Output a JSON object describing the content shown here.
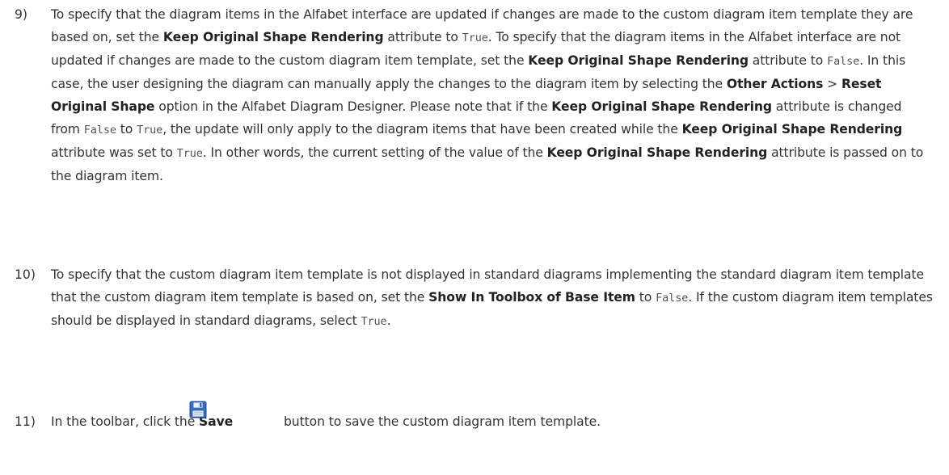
{
  "colors": {
    "text": "#333333",
    "bold_text": "#222222",
    "code_text": "#555555",
    "save_icon": "#3a6fc4"
  },
  "step9": {
    "number": "9)",
    "p1": "To specify that the diagram items in the Alfabet interface are updated if changes are made to the custom diagram item template they are based on, set the ",
    "b1": "Keep Original Shape Rendering",
    "p2": " attribute to ",
    "c1": "True",
    "p3": ". To specify that the diagram items in the Alfabet interface are not updated if changes are made to the custom diagram item template, set the ",
    "b2": "Keep Original Shape Rendering",
    "p4": " attribute to ",
    "c2": "False",
    "p5": ". In this case, the user designing the diagram can manually apply the changes to the diagram item by selecting the ",
    "b3": "Other Actions",
    "p6": " > ",
    "b4": "Reset Original Shape",
    "p7": " option in the Alfabet Diagram Designer. Please note that if the ",
    "b5": "Keep Original Shape Rendering",
    "p8": " attribute is changed from ",
    "c3": "False",
    "p9": " to ",
    "c4": "True",
    "p10": ", the update will only apply to the diagram items that have been created while the ",
    "b6": "Keep Original Shape Rendering",
    "p11": " attribute was set to ",
    "c5": "True",
    "p12": ". In other words, the current setting of the value of the ",
    "b7": "Keep Original Shape Rendering",
    "p13": " attribute is passed on to the diagram item."
  },
  "step10": {
    "number": "10)",
    "p1": "To specify that the custom diagram item template is not displayed in standard diagrams implementing the standard diagram item template that the custom diagram item template is based on, set the ",
    "b1": "Show In Toolbox of Base Item",
    "p2": " to ",
    "c1": "False",
    "p3": ". If the custom diagram item templates should be displayed in standard diagrams, select ",
    "c2": "True",
    "p4": "."
  },
  "step11": {
    "number": "11)",
    "p1": "In the toolbar, click the ",
    "b1": "Save",
    "icon": "save-icon",
    "p2": " button to save the custom diagram item template."
  }
}
